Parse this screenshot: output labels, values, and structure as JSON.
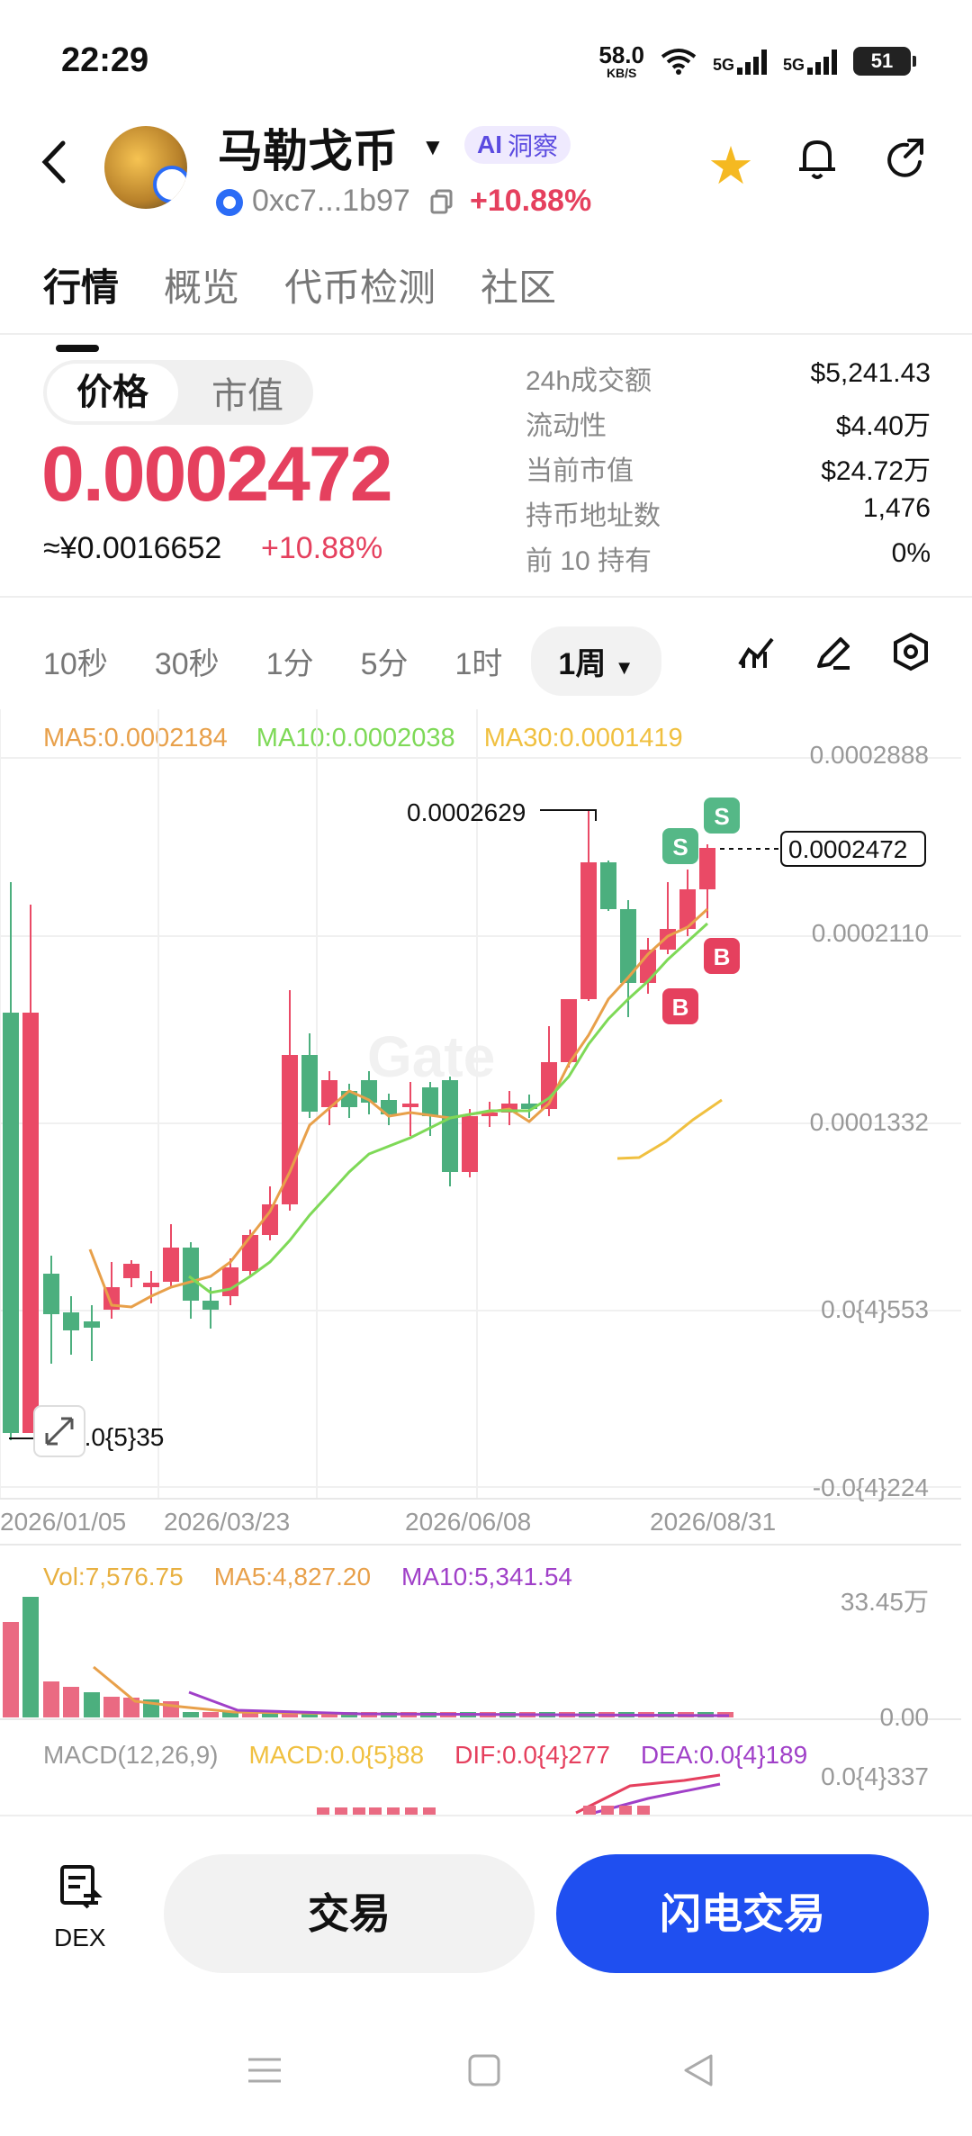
{
  "status": {
    "time": "22:29",
    "speed_value": "58.0",
    "speed_unit": "KB/S",
    "sig1": "5G",
    "sig2": "5G",
    "battery": "51"
  },
  "header": {
    "title": "马勒戈币",
    "ai_label": "洞察",
    "address": "0xc7...1b97",
    "change": "+10.88%"
  },
  "tabs": [
    "行情",
    "概览",
    "代币检测",
    "社区"
  ],
  "price": {
    "toggle": [
      "价格",
      "市值"
    ],
    "value": "0.0002472",
    "cny": "≈¥0.0016652",
    "cny_change": "+10.88%"
  },
  "stats": [
    {
      "k": "24h成交额",
      "v": "$5,241.43"
    },
    {
      "k": "流动性",
      "v": "$4.40万"
    },
    {
      "k": "当前市值",
      "v": "$24.72万"
    },
    {
      "k": "持币地址数",
      "v": "1,476"
    },
    {
      "k": "前 10 持有",
      "v": "0%"
    }
  ],
  "timeframes": [
    "10秒",
    "30秒",
    "1分",
    "5分",
    "1时"
  ],
  "timeframe_selected": "1周",
  "legend": {
    "ma5": "MA5:0.0002184",
    "ma10": "MA10:0.0002038",
    "ma30": "MA30:0.0001419"
  },
  "watermark": "Gate",
  "chart_data": {
    "type": "candlestick",
    "y_axis_labels": [
      "0.0002888",
      "0.0002110",
      "0.0001332",
      "0.0{4}553",
      "-0.0{4}224"
    ],
    "x_axis_labels": [
      "2026/01/05",
      "2026/03/23",
      "2026/06/08",
      "2026/08/31"
    ],
    "high_label": "0.0002629",
    "low_label": "0.0{5}35",
    "current_label": "0.0002472",
    "markers": [
      "S",
      "S",
      "B",
      "B"
    ],
    "series": [
      {
        "name": "MA5"
      },
      {
        "name": "MA10"
      },
      {
        "name": "MA30"
      }
    ]
  },
  "volume": {
    "vol": "Vol:7,576.75",
    "ma5": "MA5:4,827.20",
    "ma10": "MA10:5,341.54",
    "max": "33.45万",
    "min": "0.00"
  },
  "macd": {
    "title": "MACD(12,26,9)",
    "macd": "MACD:0.0{5}88",
    "dif": "DIF:0.0{4}277",
    "dea": "DEA:0.0{4}189",
    "max": "0.0{4}337"
  },
  "bottom": {
    "dex": "DEX",
    "trade": "交易",
    "flash": "闪电交易"
  },
  "colors": {
    "up": "#ea4a66",
    "down": "#4caf7e",
    "accent": "#1f4ff0",
    "ma5": "#e8a04a",
    "ma10": "#7ed957",
    "ma30": "#f0c040"
  }
}
